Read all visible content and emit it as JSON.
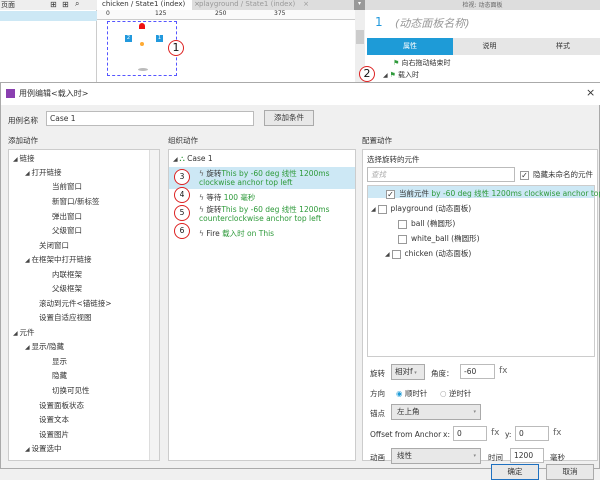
{
  "top": {
    "left_panel_title": "页面",
    "tabs": [
      {
        "label": "chicken / State1 (index)"
      },
      {
        "label": "playground / State1 (index)"
      }
    ],
    "ruler": [
      "0",
      "125",
      "250",
      "375"
    ],
    "right_header": "检视: 动态面板",
    "panel_number": "1",
    "panel_name": "(动态面板名称)",
    "prop_tabs": [
      "属性",
      "说明",
      "样式"
    ],
    "events": [
      "向右拖动结束时",
      "载入时"
    ]
  },
  "dialog": {
    "title": "用例编辑<载入时>",
    "case_name_label": "用例名称",
    "case_name": "Case 1",
    "add_condition": "添加条件",
    "add_action": {
      "heading": "添加动作",
      "items": [
        "链接",
        "打开链接",
        "当前窗口",
        "新窗口/新标签",
        "弹出窗口",
        "父级窗口",
        "关闭窗口",
        "在框架中打开链接",
        "内联框架",
        "父级框架",
        "滚动到元件<锚链接>",
        "设置自适应视图",
        "元件",
        "显示/隐藏",
        "显示",
        "隐藏",
        "切换可见性",
        "设置面板状态",
        "设置文本",
        "设置图片",
        "设置选中"
      ]
    },
    "organize": {
      "heading": "组织动作",
      "case": "Case 1",
      "actions": [
        {
          "badge": "3",
          "verb": "旋转",
          "detail": "This by -60 deg 线性 1200ms clockwise anchor top left"
        },
        {
          "badge": "4",
          "verb": "等待",
          "detail": "100 毫秒"
        },
        {
          "badge": "5",
          "verb": "旋转",
          "detail": "This by -60 deg 线性 1200ms counterclockwise anchor top left"
        },
        {
          "badge": "6",
          "verb": "Fire",
          "detail": "载入时 on This"
        }
      ]
    },
    "configure": {
      "heading": "配置动作",
      "select_label": "选择旋转的元件",
      "search_placeholder": "查找",
      "hide_unnamed": "隐藏未命名的元件",
      "targets": [
        {
          "name": "当前元件",
          "detail": "by -60 deg 线性 1200ms clockwise anchor top left",
          "checked": true
        },
        {
          "name": "playground (动态面板)",
          "checked": false
        },
        {
          "name": "ball (椭圆形)",
          "checked": false
        },
        {
          "name": "white_ball (椭圆形)",
          "checked": false
        },
        {
          "name": "chicken (动态面板)",
          "checked": false
        }
      ],
      "rotate_label": "旋转",
      "rotate_mode": "相对f",
      "angle_label": "角度：",
      "angle": "-60",
      "fx": "fx",
      "direction_label": "方向",
      "cw": "顺时针",
      "ccw": "逆时针",
      "anchor_label": "锚点",
      "anchor": "左上角",
      "offset_label": "Offset from Anchor",
      "x_label": "x:",
      "x": "0",
      "y_label": "y:",
      "y": "0",
      "anim_label": "动画",
      "anim": "线性",
      "time_label": "时间",
      "time": "1200",
      "ms": "毫秒"
    },
    "ok": "确定",
    "cancel": "取消"
  },
  "badges": {
    "b1": "1",
    "b2": "2"
  },
  "colors": {
    "accent": "#1e9bd7",
    "green": "#2e9a3a",
    "selected": "#cde8f5"
  }
}
